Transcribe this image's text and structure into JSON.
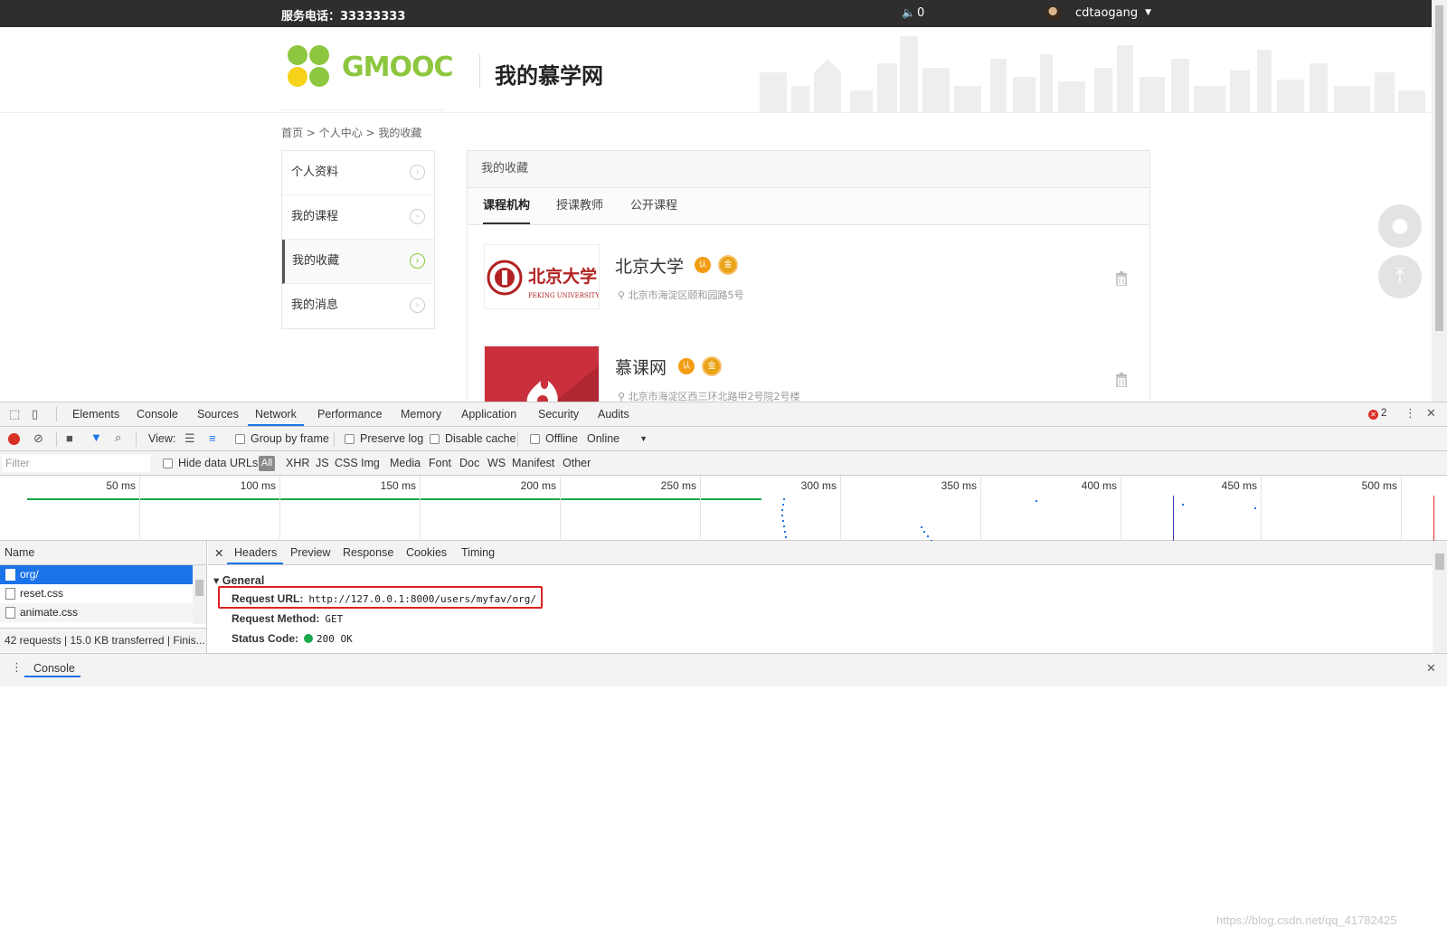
{
  "site": {
    "topbar": {
      "phone": "服务电话：33333333",
      "notice_count": "0",
      "username": "cdtaogang"
    },
    "logo_text": "GMOOC",
    "site_title": "我的慕学网",
    "breadcrumb": {
      "home": "首页",
      "sep": " > ",
      "center": "个人中心",
      "current": "我的收藏"
    },
    "leftnav": [
      {
        "label": "个人资料"
      },
      {
        "label": "我的课程"
      },
      {
        "label": "我的收藏",
        "active": true
      },
      {
        "label": "我的消息"
      }
    ],
    "panel_title": "我的收藏",
    "tabs": [
      "课程机构",
      "授课教师",
      "公开课程"
    ],
    "favorites": [
      {
        "name": "北京大学",
        "address": "北京市海淀区颐和园路5号",
        "logo_text": "北京大学",
        "logo_sub": "PEKING UNIVERSITY"
      },
      {
        "name": "慕课网",
        "address": "北京市海淀区西三环北路甲2号院2号楼"
      }
    ],
    "badge_renzheng": "认",
    "badge_gold": "金"
  },
  "devtools": {
    "tabs": [
      "Elements",
      "Console",
      "Sources",
      "Network",
      "Performance",
      "Memory",
      "Application",
      "Security",
      "Audits"
    ],
    "active_tab": "Network",
    "error_count": "2",
    "toolbar": {
      "view_label": "View:",
      "group_by_frame": "Group by frame",
      "preserve_log": "Preserve log",
      "disable_cache": "Disable cache",
      "offline": "Offline",
      "throttle": "Online"
    },
    "filter": {
      "placeholder": "Filter",
      "hide_data_urls": "Hide data URLs",
      "types": [
        "All",
        "XHR",
        "JS",
        "CSS",
        "Img",
        "Media",
        "Font",
        "Doc",
        "WS",
        "Manifest",
        "Other"
      ]
    },
    "timeline_ticks": [
      "50 ms",
      "100 ms",
      "150 ms",
      "200 ms",
      "250 ms",
      "300 ms",
      "350 ms",
      "400 ms",
      "450 ms",
      "500 ms"
    ],
    "name_header": "Name",
    "requests": [
      "org/",
      "reset.css",
      "animate.css"
    ],
    "summary": "42 requests | 15.0 KB transferred | Finis...",
    "detail_tabs": [
      "Headers",
      "Preview",
      "Response",
      "Cookies",
      "Timing"
    ],
    "general_label": "General",
    "request_url_key": "Request URL:",
    "request_url": "http://127.0.0.1:8000/users/myfav/org/",
    "request_method_key": "Request Method:",
    "request_method": "GET",
    "status_code_key": "Status Code:",
    "status_code": "200 OK",
    "console_drawer_tab": "Console",
    "watermark": "https://blog.csdn.net/qq_41782425"
  }
}
